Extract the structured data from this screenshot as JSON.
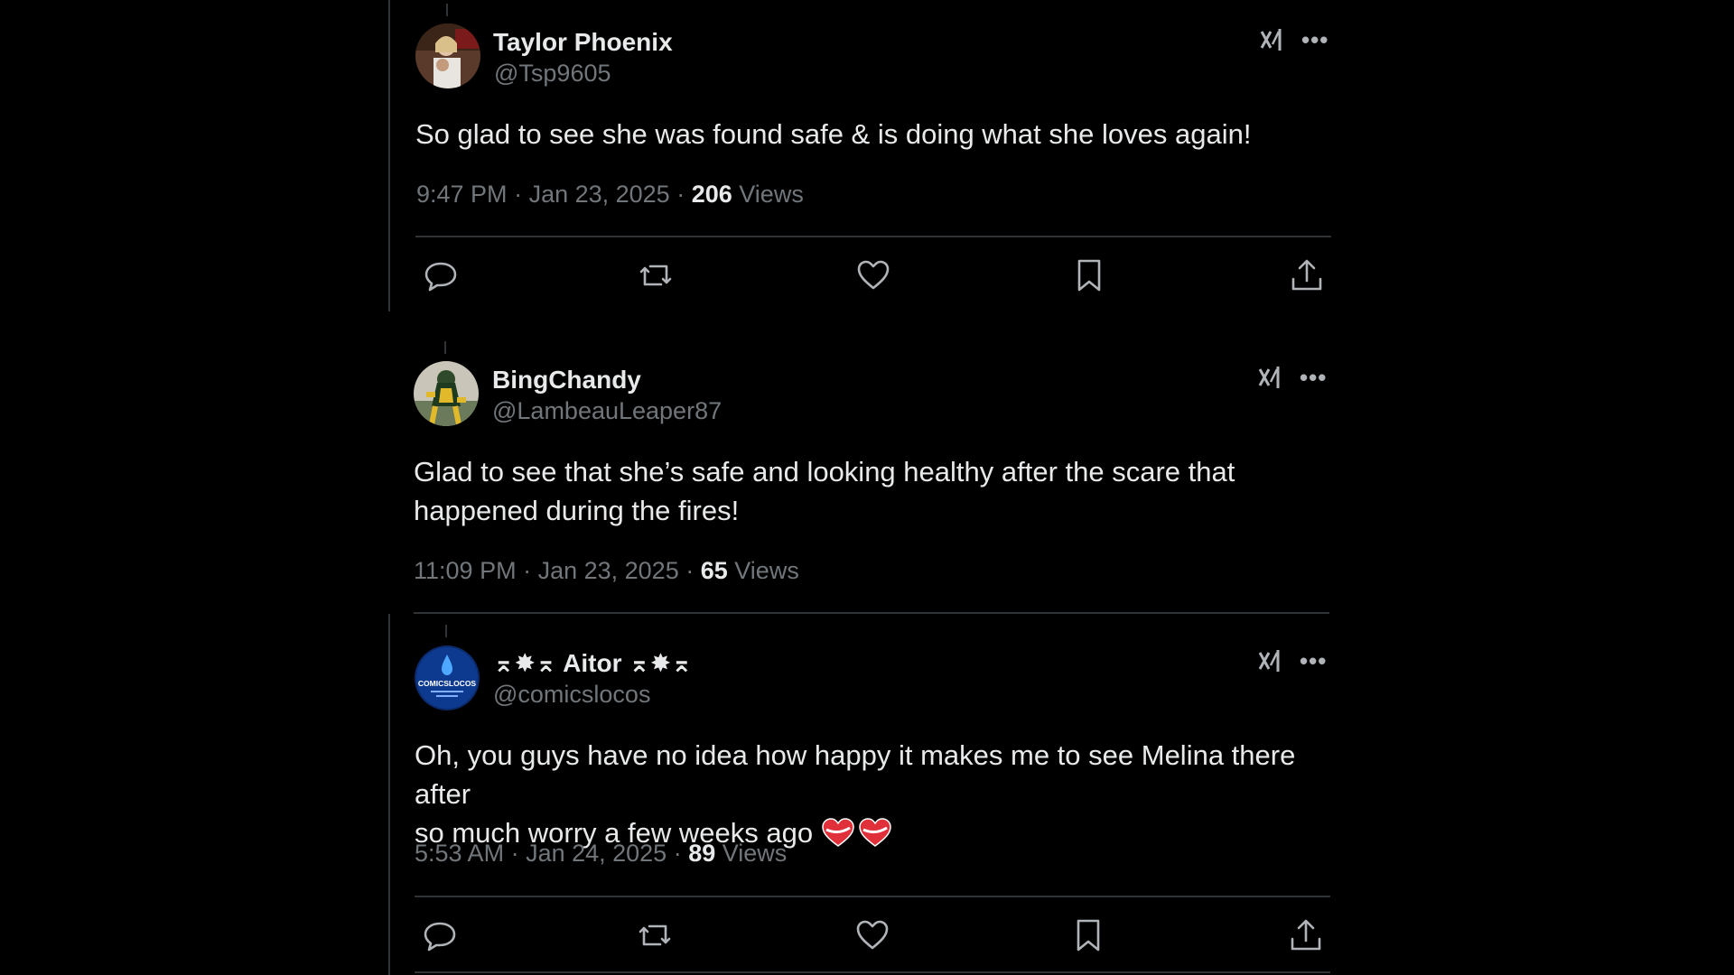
{
  "posts": [
    {
      "display_name": "Taylor Phoenix",
      "handle": "@Tsp9605",
      "text": "So glad to see she was found safe & is doing what she loves again!",
      "time": "9:47 PM",
      "date": "Jan 23, 2025",
      "views_count": "206",
      "views_label": "Views",
      "avatar_icon": "user-photo-avatar"
    },
    {
      "display_name": "BingChandy",
      "handle": "@LambeauLeaper87",
      "text_line1": "Glad to see that she’s safe and looking healthy after the scare that",
      "text_line2": "happened during the fires!",
      "time": "11:09 PM",
      "date": "Jan 23, 2025",
      "views_count": "65",
      "views_label": "Views",
      "avatar_icon": "football-player-avatar"
    },
    {
      "display_name_prefix": "⌅✸⌅",
      "display_name": "Aitor",
      "display_name_suffix": "⌅✸⌅",
      "handle": "@comicslocos",
      "text_line1": "Oh, you guys have no idea how happy it makes me to see Melina there after",
      "text_line2": "so much worry a few weeks ago",
      "time": "5:53 AM",
      "date": "Jan 24, 2025",
      "views_count": "89",
      "views_label": "Views",
      "avatar_icon": "comicslocos-logo-avatar",
      "avatar_text": "COMICSLOCOS"
    }
  ],
  "separator": " · ",
  "colors": {
    "background": "#000000",
    "text": "#e7e9ea",
    "muted": "#71767b",
    "divider": "#2f3336"
  }
}
